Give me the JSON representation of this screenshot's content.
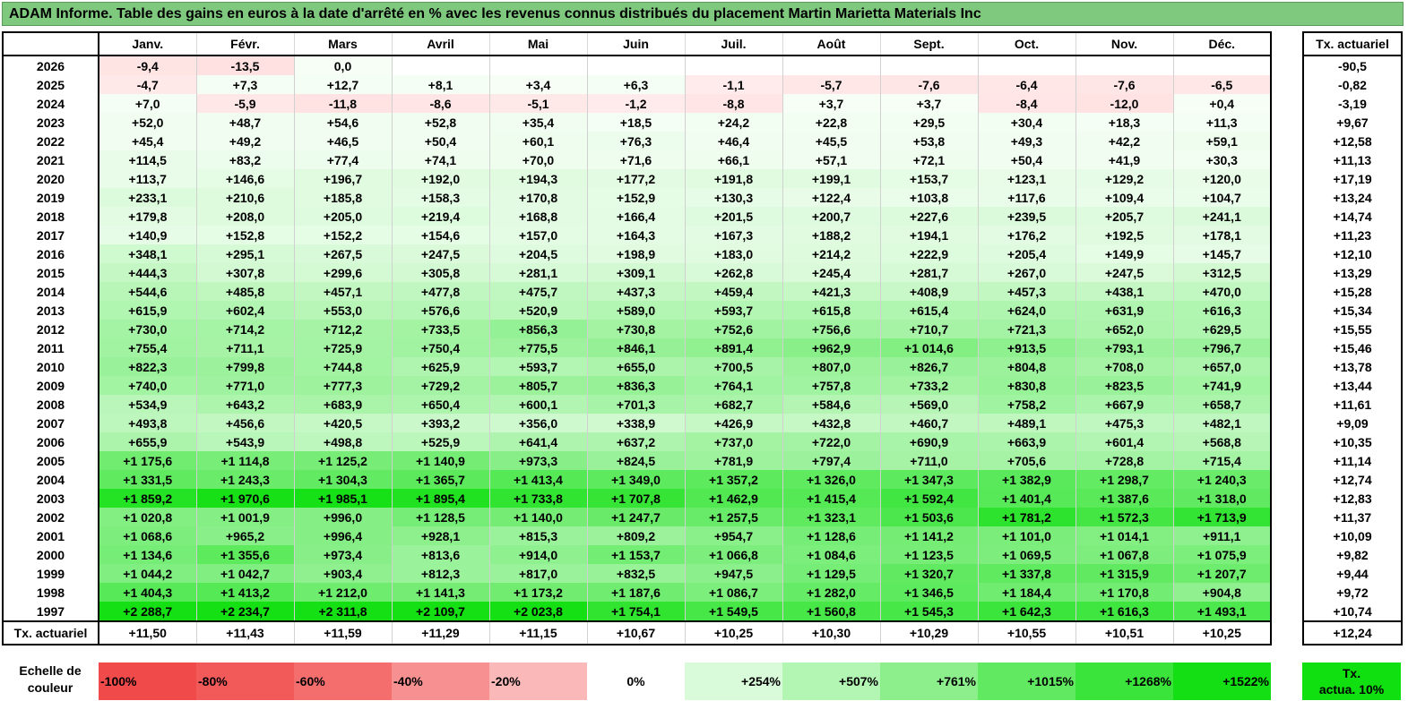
{
  "title": "ADAM Informe. Table des gains en euros à la date d'arrêté en % avec les revenus connus distribués du placement Martin Marietta Materials Inc",
  "months": [
    "Janv.",
    "Févr.",
    "Mars",
    "Avril",
    "Mai",
    "Juin",
    "Juil.",
    "Août",
    "Sept.",
    "Oct.",
    "Nov.",
    "Déc."
  ],
  "rate_header": "Tx. actuariel",
  "rows": [
    {
      "year": "2026",
      "values": [
        "-9,4",
        "-13,5",
        "0,0",
        "",
        "",
        "",
        "",
        "",
        "",
        "",
        "",
        ""
      ],
      "rate": "-90,5"
    },
    {
      "year": "2025",
      "values": [
        "-4,7",
        "+7,3",
        "+12,7",
        "+8,1",
        "+3,4",
        "+6,3",
        "-1,1",
        "-5,7",
        "-7,6",
        "-6,4",
        "-7,6",
        "-6,5"
      ],
      "rate": "-0,82"
    },
    {
      "year": "2024",
      "values": [
        "+7,0",
        "-5,9",
        "-11,8",
        "-8,6",
        "-5,1",
        "-1,2",
        "-8,8",
        "+3,7",
        "+3,7",
        "-8,4",
        "-12,0",
        "+0,4"
      ],
      "rate": "-3,19"
    },
    {
      "year": "2023",
      "values": [
        "+52,0",
        "+48,7",
        "+54,6",
        "+52,8",
        "+35,4",
        "+18,5",
        "+24,2",
        "+22,8",
        "+29,5",
        "+30,4",
        "+18,3",
        "+11,3"
      ],
      "rate": "+9,67"
    },
    {
      "year": "2022",
      "values": [
        "+45,4",
        "+49,2",
        "+46,5",
        "+50,4",
        "+60,1",
        "+76,3",
        "+46,4",
        "+45,5",
        "+53,8",
        "+49,3",
        "+42,2",
        "+59,1"
      ],
      "rate": "+12,58"
    },
    {
      "year": "2021",
      "values": [
        "+114,5",
        "+83,2",
        "+77,4",
        "+74,1",
        "+70,0",
        "+71,6",
        "+66,1",
        "+57,1",
        "+72,1",
        "+50,4",
        "+41,9",
        "+30,3"
      ],
      "rate": "+11,13"
    },
    {
      "year": "2020",
      "values": [
        "+113,7",
        "+146,6",
        "+196,7",
        "+192,0",
        "+194,3",
        "+177,2",
        "+191,8",
        "+199,1",
        "+153,7",
        "+123,1",
        "+129,2",
        "+120,0"
      ],
      "rate": "+17,19"
    },
    {
      "year": "2019",
      "values": [
        "+233,1",
        "+210,6",
        "+185,8",
        "+158,3",
        "+170,8",
        "+152,9",
        "+130,3",
        "+122,4",
        "+103,8",
        "+117,6",
        "+109,4",
        "+104,7"
      ],
      "rate": "+13,24"
    },
    {
      "year": "2018",
      "values": [
        "+179,8",
        "+208,0",
        "+205,0",
        "+219,4",
        "+168,8",
        "+166,4",
        "+201,5",
        "+200,7",
        "+227,6",
        "+239,5",
        "+205,7",
        "+241,1"
      ],
      "rate": "+14,74"
    },
    {
      "year": "2017",
      "values": [
        "+140,9",
        "+152,8",
        "+152,2",
        "+154,6",
        "+157,0",
        "+164,3",
        "+167,3",
        "+188,2",
        "+194,1",
        "+176,2",
        "+192,5",
        "+178,1"
      ],
      "rate": "+11,23"
    },
    {
      "year": "2016",
      "values": [
        "+348,1",
        "+295,1",
        "+267,5",
        "+247,5",
        "+204,5",
        "+198,9",
        "+183,0",
        "+214,2",
        "+222,9",
        "+205,4",
        "+149,9",
        "+145,7"
      ],
      "rate": "+12,10"
    },
    {
      "year": "2015",
      "values": [
        "+444,3",
        "+307,8",
        "+299,6",
        "+305,8",
        "+281,1",
        "+309,1",
        "+262,8",
        "+245,4",
        "+281,7",
        "+267,0",
        "+247,5",
        "+312,5"
      ],
      "rate": "+13,29"
    },
    {
      "year": "2014",
      "values": [
        "+544,6",
        "+485,8",
        "+457,1",
        "+477,8",
        "+475,7",
        "+437,3",
        "+459,4",
        "+421,3",
        "+408,9",
        "+457,3",
        "+438,1",
        "+470,0"
      ],
      "rate": "+15,28"
    },
    {
      "year": "2013",
      "values": [
        "+615,9",
        "+602,4",
        "+553,0",
        "+576,6",
        "+520,9",
        "+589,0",
        "+593,7",
        "+615,8",
        "+615,4",
        "+624,0",
        "+631,9",
        "+616,3"
      ],
      "rate": "+15,34"
    },
    {
      "year": "2012",
      "values": [
        "+730,0",
        "+714,2",
        "+712,2",
        "+733,5",
        "+856,3",
        "+730,8",
        "+752,6",
        "+756,6",
        "+710,7",
        "+721,3",
        "+652,0",
        "+629,5"
      ],
      "rate": "+15,55"
    },
    {
      "year": "2011",
      "values": [
        "+755,4",
        "+711,1",
        "+725,9",
        "+750,4",
        "+775,5",
        "+846,1",
        "+891,4",
        "+962,9",
        "+1 014,6",
        "+913,5",
        "+793,1",
        "+796,7"
      ],
      "rate": "+15,46"
    },
    {
      "year": "2010",
      "values": [
        "+822,3",
        "+799,8",
        "+744,8",
        "+625,9",
        "+593,7",
        "+655,0",
        "+700,5",
        "+807,0",
        "+826,7",
        "+804,8",
        "+708,0",
        "+657,0"
      ],
      "rate": "+13,78"
    },
    {
      "year": "2009",
      "values": [
        "+740,0",
        "+771,0",
        "+777,3",
        "+729,2",
        "+805,7",
        "+836,3",
        "+764,1",
        "+757,8",
        "+733,2",
        "+830,8",
        "+823,5",
        "+741,9"
      ],
      "rate": "+13,44"
    },
    {
      "year": "2008",
      "values": [
        "+534,9",
        "+643,2",
        "+683,9",
        "+650,4",
        "+600,1",
        "+701,3",
        "+682,7",
        "+584,6",
        "+569,0",
        "+758,2",
        "+667,9",
        "+658,7"
      ],
      "rate": "+11,61"
    },
    {
      "year": "2007",
      "values": [
        "+493,8",
        "+456,6",
        "+420,5",
        "+393,2",
        "+356,0",
        "+338,9",
        "+426,9",
        "+432,8",
        "+460,7",
        "+489,1",
        "+475,3",
        "+482,1"
      ],
      "rate": "+9,09"
    },
    {
      "year": "2006",
      "values": [
        "+655,9",
        "+543,9",
        "+498,8",
        "+525,9",
        "+641,4",
        "+637,2",
        "+737,0",
        "+722,0",
        "+690,9",
        "+663,9",
        "+601,4",
        "+568,8"
      ],
      "rate": "+10,35"
    },
    {
      "year": "2005",
      "values": [
        "+1 175,6",
        "+1 114,8",
        "+1 125,2",
        "+1 140,9",
        "+973,3",
        "+824,5",
        "+781,9",
        "+797,4",
        "+711,0",
        "+705,6",
        "+728,8",
        "+715,4"
      ],
      "rate": "+11,14"
    },
    {
      "year": "2004",
      "values": [
        "+1 331,5",
        "+1 243,3",
        "+1 304,3",
        "+1 365,7",
        "+1 413,4",
        "+1 349,0",
        "+1 357,2",
        "+1 326,0",
        "+1 347,3",
        "+1 382,9",
        "+1 298,7",
        "+1 240,3"
      ],
      "rate": "+12,74"
    },
    {
      "year": "2003",
      "values": [
        "+1 859,2",
        "+1 970,6",
        "+1 985,1",
        "+1 895,4",
        "+1 733,8",
        "+1 707,8",
        "+1 462,9",
        "+1 415,4",
        "+1 592,4",
        "+1 401,4",
        "+1 387,6",
        "+1 318,0"
      ],
      "rate": "+12,83"
    },
    {
      "year": "2002",
      "values": [
        "+1 020,8",
        "+1 001,9",
        "+996,0",
        "+1 128,5",
        "+1 140,0",
        "+1 247,7",
        "+1 257,5",
        "+1 323,1",
        "+1 503,6",
        "+1 781,2",
        "+1 572,3",
        "+1 713,9"
      ],
      "rate": "+11,37"
    },
    {
      "year": "2001",
      "values": [
        "+1 068,6",
        "+965,2",
        "+996,4",
        "+928,1",
        "+815,3",
        "+809,2",
        "+954,7",
        "+1 128,6",
        "+1 141,2",
        "+1 101,0",
        "+1 014,1",
        "+911,1"
      ],
      "rate": "+10,09"
    },
    {
      "year": "2000",
      "values": [
        "+1 134,6",
        "+1 355,6",
        "+973,4",
        "+813,6",
        "+914,0",
        "+1 153,7",
        "+1 066,8",
        "+1 084,6",
        "+1 123,5",
        "+1 069,5",
        "+1 067,8",
        "+1 075,9"
      ],
      "rate": "+9,82"
    },
    {
      "year": "1999",
      "values": [
        "+1 044,2",
        "+1 042,7",
        "+903,4",
        "+812,3",
        "+817,0",
        "+832,5",
        "+947,5",
        "+1 129,5",
        "+1 320,7",
        "+1 337,8",
        "+1 315,9",
        "+1 207,7"
      ],
      "rate": "+9,44"
    },
    {
      "year": "1998",
      "values": [
        "+1 404,3",
        "+1 413,2",
        "+1 212,0",
        "+1 141,3",
        "+1 173,2",
        "+1 187,6",
        "+1 086,7",
        "+1 282,0",
        "+1 346,5",
        "+1 184,4",
        "+1 170,8",
        "+904,8"
      ],
      "rate": "+9,72"
    },
    {
      "year": "1997",
      "values": [
        "+2 288,7",
        "+2 234,7",
        "+2 311,8",
        "+2 109,7",
        "+2 023,8",
        "+1 754,1",
        "+1 549,5",
        "+1 560,8",
        "+1 545,3",
        "+1 642,3",
        "+1 616,3",
        "+1 493,1"
      ],
      "rate": "+10,74"
    }
  ],
  "footer": {
    "label": "Tx. actuariel",
    "values": [
      "+11,50",
      "+11,43",
      "+11,59",
      "+11,29",
      "+11,15",
      "+10,67",
      "+10,25",
      "+10,30",
      "+10,29",
      "+10,55",
      "+10,51",
      "+10,25"
    ],
    "rate": "+12,24"
  },
  "scale": {
    "label_line1": "Echelle de",
    "label_line2": "couleur",
    "items": [
      {
        "label": "-100%",
        "color": "#f04a4a",
        "kind": "neg"
      },
      {
        "label": "-80%",
        "color": "#f25a5a",
        "kind": "neg"
      },
      {
        "label": "-60%",
        "color": "#f46e6e",
        "kind": "neg"
      },
      {
        "label": "-40%",
        "color": "#f79090",
        "kind": "neg"
      },
      {
        "label": "-20%",
        "color": "#fab8b8",
        "kind": "neg"
      },
      {
        "label": "0%",
        "color": "#ffffff",
        "kind": "zero"
      },
      {
        "label": "+254%",
        "color": "#d9fbd9",
        "kind": "pos"
      },
      {
        "label": "+507%",
        "color": "#b3f5b3",
        "kind": "pos"
      },
      {
        "label": "+761%",
        "color": "#8cef8c",
        "kind": "pos"
      },
      {
        "label": "+1015%",
        "color": "#62e962",
        "kind": "pos"
      },
      {
        "label": "+1268%",
        "color": "#3be43b",
        "kind": "pos"
      },
      {
        "label": "+1522%",
        "color": "#14df14",
        "kind": "pos"
      }
    ],
    "rate_line1": "Tx.",
    "rate_line2": "actua. 10%",
    "rate_color": "#10e010"
  }
}
